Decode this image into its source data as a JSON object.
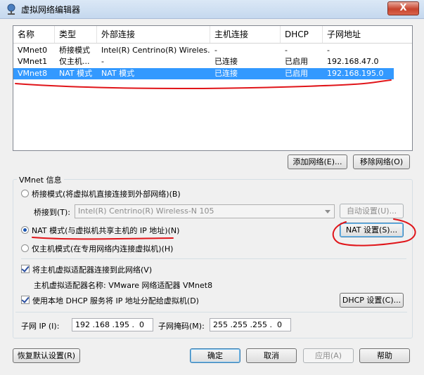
{
  "window": {
    "title": "虚拟网络编辑器",
    "close_glyph": "X"
  },
  "table": {
    "columns": [
      "名称",
      "类型",
      "外部连接",
      "主机连接",
      "DHCP",
      "子网地址"
    ],
    "rows": [
      {
        "name": "VMnet0",
        "type": "桥接模式",
        "external": "Intel(R) Centrino(R) Wireles...",
        "host": "-",
        "dhcp": "-",
        "subnet": "-"
      },
      {
        "name": "VMnet1",
        "type": "仅主机...",
        "external": "-",
        "host": "已连接",
        "dhcp": "已启用",
        "subnet": "192.168.47.0"
      },
      {
        "name": "VMnet8",
        "type": "NAT 模式",
        "external": "NAT 模式",
        "host": "已连接",
        "dhcp": "已启用",
        "subnet": "192.168.195.0"
      }
    ],
    "selected_index": 2
  },
  "table_buttons": {
    "add": "添加网络(E)...",
    "remove": "移除网络(O)"
  },
  "vmnet_info": {
    "group_title": "VMnet 信息",
    "bridge_radio": "桥接模式(将虚拟机直接连接到外部网络)(B)",
    "bridge_to_label": "桥接到(T):",
    "bridge_to_value": "Intel(R) Centrino(R) Wireless-N 105",
    "auto_settings": "自动设置(U)...",
    "nat_radio": "NAT 模式(与虚拟机共享主机的 IP 地址)(N)",
    "nat_settings": "NAT 设置(S)...",
    "hostonly_radio": "仅主机模式(在专用网络内连接虚拟机)(H)",
    "selected_mode": "nat",
    "connect_adapter_check": "将主机虚拟适配器连接到此网络(V)",
    "adapter_name_line": "主机虚拟适配器名称: VMware 网络适配器 VMnet8",
    "dhcp_check": "使用本地 DHCP 服务将 IP 地址分配给虚拟机(D)",
    "dhcp_settings": "DHCP 设置(C)...",
    "subnet_ip_label": "子网 IP (I):",
    "subnet_ip_value": "192 .168 .195 .  0",
    "subnet_mask_label": "子网掩码(M):",
    "subnet_mask_value": "255 .255 .255 .  0"
  },
  "footer": {
    "restore": "恢复默认设置(R)",
    "ok": "确定",
    "cancel": "取消",
    "apply": "应用(A)",
    "help": "帮助"
  },
  "colors": {
    "selection": "#3399ff",
    "annotation": "#e0151a"
  }
}
